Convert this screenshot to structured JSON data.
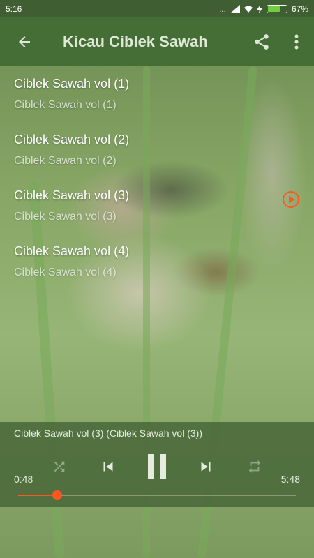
{
  "colors": {
    "statusbar": "#3f5f33",
    "appbar": "#456d36",
    "accent": "#ff5722",
    "battery": "#6fcf3f"
  },
  "status": {
    "time": "5:16",
    "dots": "...",
    "battery_pct": "67%",
    "battery_level": 0.67
  },
  "appbar": {
    "title": "Kicau Ciblek Sawah",
    "back_icon": "arrow-left-icon",
    "share_icon": "share-icon",
    "menu_icon": "more-vert-icon"
  },
  "playlist": [
    {
      "title": "Ciblek Sawah vol (1)",
      "subtitle": "Ciblek Sawah vol (1)",
      "playing": false
    },
    {
      "title": "Ciblek Sawah vol (2)",
      "subtitle": "Ciblek Sawah vol (2)",
      "playing": false
    },
    {
      "title": "Ciblek Sawah vol (3)",
      "subtitle": "Ciblek Sawah vol (3)",
      "playing": true
    },
    {
      "title": "Ciblek Sawah vol (4)",
      "subtitle": "Ciblek Sawah vol (4)",
      "playing": false
    }
  ],
  "player": {
    "now_playing": "Ciblek Sawah vol (3) (Ciblek Sawah vol (3))",
    "elapsed": "0:48",
    "duration": "5:48",
    "progress": 0.14,
    "icons": [
      "shuffle-icon",
      "skip-previous-icon",
      "pause-icon",
      "skip-next-icon",
      "repeat-icon"
    ]
  }
}
